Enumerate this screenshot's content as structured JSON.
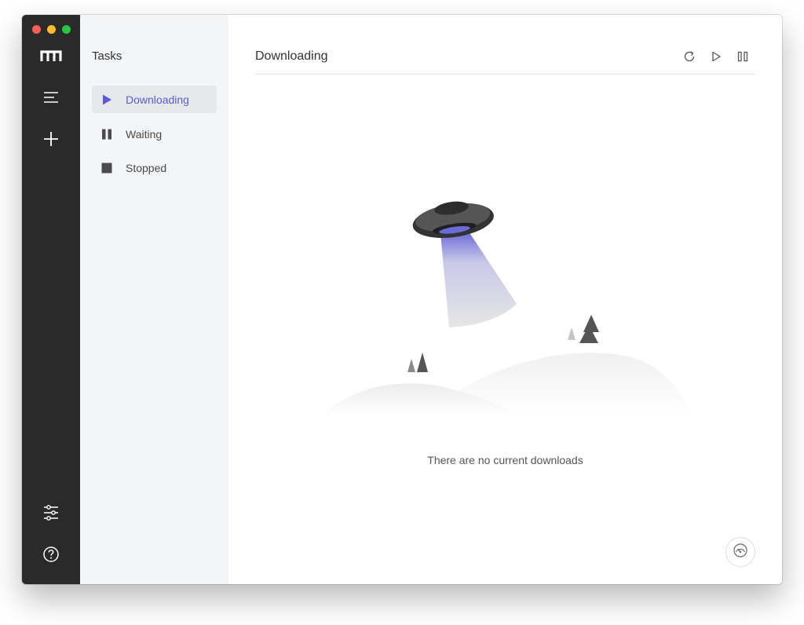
{
  "sidebar": {
    "title": "Tasks",
    "items": [
      {
        "label": "Downloading",
        "icon": "play-icon",
        "active": true
      },
      {
        "label": "Waiting",
        "icon": "pause-icon",
        "active": false
      },
      {
        "label": "Stopped",
        "icon": "stop-icon",
        "active": false
      }
    ]
  },
  "main": {
    "title": "Downloading",
    "empty_message": "There are no current downloads"
  },
  "rail": {
    "icons": [
      "app-logo-icon",
      "menu-icon",
      "add-icon",
      "settings-sliders-icon",
      "help-icon"
    ]
  },
  "toolbar": {
    "icons": [
      "refresh-icon",
      "resume-all-icon",
      "pause-all-icon"
    ]
  },
  "colors": {
    "rail_bg": "#2a2a2a",
    "sidebar_bg": "#f4f5f7",
    "accent": "#5b5bd6",
    "active_item_bg": "#e6e8ec"
  }
}
